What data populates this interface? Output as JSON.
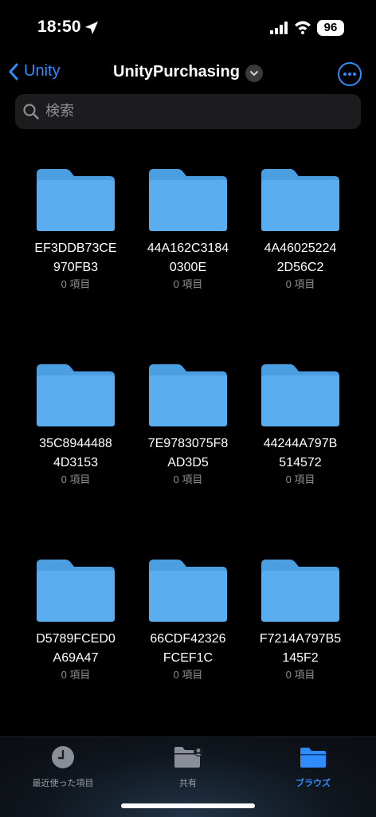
{
  "status": {
    "time": "18:50",
    "battery": "96"
  },
  "nav": {
    "back_label": "Unity",
    "title": "UnityPurchasing"
  },
  "search": {
    "placeholder": "検索"
  },
  "folders": [
    {
      "name": "EF3DDB73CE\n970FB3",
      "count": "0 項目"
    },
    {
      "name": "44A162C3184\n0300E",
      "count": "0 項目"
    },
    {
      "name": "4A46025224\n2D56C2",
      "count": "0 項目"
    },
    {
      "name": "35C8944488\n4D3153",
      "count": "0 項目"
    },
    {
      "name": "7E9783075F8\nAD3D5",
      "count": "0 項目"
    },
    {
      "name": "44244A797B\n514572",
      "count": "0 項目"
    },
    {
      "name": "D5789FCED0\nA69A47",
      "count": "0 項目"
    },
    {
      "name": "66CDF42326\nFCEF1C",
      "count": "0 項目"
    },
    {
      "name": "F7214A797B5\n145F2",
      "count": "0 項目"
    }
  ],
  "tabs": [
    {
      "label": "最近使った項目",
      "icon": "clock-icon",
      "active": false
    },
    {
      "label": "共有",
      "icon": "shared-folder-icon",
      "active": false
    },
    {
      "label": "ブラウズ",
      "icon": "folder-icon",
      "active": true
    }
  ],
  "colors": {
    "accent": "#2f8cff",
    "folder": "#5aaef0",
    "folder_tab": "#4b9fe0"
  }
}
